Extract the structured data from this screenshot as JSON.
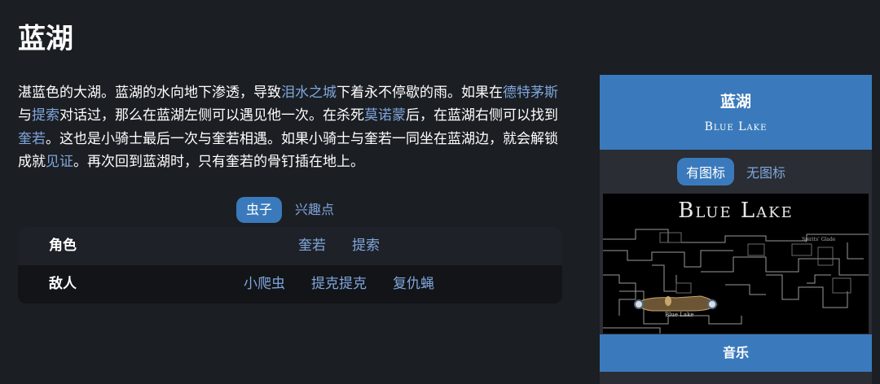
{
  "page": {
    "title": "蓝湖"
  },
  "intro": {
    "t1": "湛蓝色的大湖。蓝湖的水向地下渗透，导致",
    "l1": "泪水之城",
    "t2": "下着永不停歇的雨。如果在",
    "l2": "德特茅斯",
    "t3": "与",
    "l3": "提索",
    "t4": "对话过，那么在蓝湖左侧可以遇见他一次。在杀死",
    "l4": "莫诺蒙",
    "t5": "后，在蓝湖右侧可以找到",
    "l5": "奎若",
    "t6": "。这也是小骑士最后一次与奎若相遇。如果小骑士与奎若一同坐在蓝湖边，就会解锁成就",
    "l6": "见证",
    "t7": "。再次回到蓝湖时，只有奎若的骨钉插在地上。"
  },
  "tabs": [
    "虫子",
    "兴趣点"
  ],
  "relations": {
    "rows": [
      {
        "label": "角色",
        "links": [
          "奎若",
          "提索"
        ]
      },
      {
        "label": "敌人",
        "links": [
          "小爬虫",
          "提克提克",
          "复仇蝇"
        ]
      }
    ]
  },
  "infobox": {
    "title": "蓝湖",
    "subtitle": "Blue Lake",
    "image_tabs": [
      "有图标",
      "无图标"
    ],
    "map_title": "Blue Lake",
    "map_labels": {
      "area": "Blue Lake",
      "spring": "Spirits' Glade"
    },
    "music_label": "音乐"
  },
  "colors": {
    "accent": "#3a7abc",
    "link": "#7fa6dc",
    "background": "#1b1e23",
    "lake": "#6b5535"
  }
}
